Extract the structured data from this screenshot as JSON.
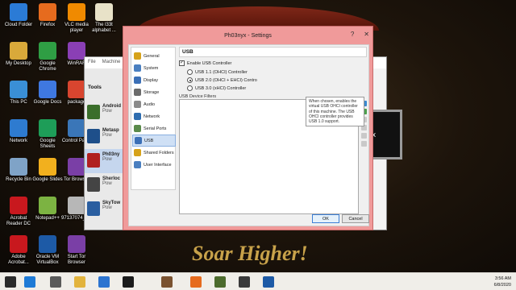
{
  "desktop_icons": [
    {
      "label": "Cloud Folder",
      "icon": "cloud-folder-icon",
      "color": "#2b7bd6"
    },
    {
      "label": "Firefox",
      "icon": "firefox-icon",
      "color": "#e66b1e"
    },
    {
      "label": "VLC media player",
      "icon": "vlc-icon",
      "color": "#f08a00"
    },
    {
      "label": "The l33t alphabet ...",
      "icon": "text-file-icon",
      "color": "#e8e2c8"
    },
    {
      "label": "My Desktop",
      "icon": "my-desktop-icon",
      "color": "#d9a93a"
    },
    {
      "label": "Google Chrome",
      "icon": "chrome-icon",
      "color": "#2f9e44"
    },
    {
      "label": "WinRAR",
      "icon": "winrar-icon",
      "color": "#8a3fb5"
    },
    {
      "label": "This PC",
      "icon": "this-pc-icon",
      "color": "#3a8fd6"
    },
    {
      "label": "Google Docs",
      "icon": "google-docs-icon",
      "color": "#3f78e0"
    },
    {
      "label": "package",
      "icon": "chrome-package-icon",
      "color": "#d8452f"
    },
    {
      "label": "Network",
      "icon": "network-icon",
      "color": "#2e7bd0"
    },
    {
      "label": "Google Sheets",
      "icon": "google-sheets-icon",
      "color": "#1e9d58"
    },
    {
      "label": "Control Panel",
      "icon": "control-panel-icon",
      "color": "#3a76b8"
    },
    {
      "label": "Recycle Bin",
      "icon": "recycle-bin-icon",
      "color": "#7fa3c7"
    },
    {
      "label": "Google Slides",
      "icon": "google-slides-icon",
      "color": "#f2b01e"
    },
    {
      "label": "Tor Browser",
      "icon": "tor-browser-icon",
      "color": "#7a3fa6"
    },
    {
      "label": "Acrobat Reader DC",
      "icon": "acrobat-icon",
      "color": "#c8181e"
    },
    {
      "label": "Notepad++",
      "icon": "notepad-plus-icon",
      "color": "#7cb342"
    },
    {
      "label": "97137074_2...",
      "icon": "image-file-icon",
      "color": "#b7b7b7"
    },
    {
      "label": "Adobe Acrobat...",
      "icon": "adobe-acrobat-icon",
      "color": "#c8181e"
    },
    {
      "label": "Oracle VM VirtualBox",
      "icon": "virtualbox-icon",
      "color": "#1d5aa6"
    },
    {
      "label": "Start Tor Browser",
      "icon": "start-tor-icon",
      "color": "#7a3fa6"
    }
  ],
  "wallpaper": {
    "slogan": "Soar Higher!"
  },
  "manager": {
    "menu": [
      "File",
      "Machine"
    ],
    "tools_label": "Tools",
    "vms": [
      {
        "name": "Android",
        "state": "Pow"
      },
      {
        "name": "Metasp",
        "state": "Pow"
      },
      {
        "name": "Ph03ny",
        "state": "Pow"
      },
      {
        "name": "Sherloc",
        "state": "Pow"
      },
      {
        "name": "SkyTow",
        "state": "Pow"
      }
    ],
    "preview_glyph": "x"
  },
  "dialog": {
    "title": "Ph03nyx - Settings",
    "controls": {
      "help": "?",
      "close": "✕"
    },
    "nav": [
      {
        "label": "General",
        "icon": "general-icon",
        "color": "#d6a21a"
      },
      {
        "label": "System",
        "icon": "system-icon",
        "color": "#4a7fc0"
      },
      {
        "label": "Display",
        "icon": "display-icon",
        "color": "#3b6fb6"
      },
      {
        "label": "Storage",
        "icon": "storage-icon",
        "color": "#6b6b6b"
      },
      {
        "label": "Audio",
        "icon": "audio-icon",
        "color": "#8a8a8a"
      },
      {
        "label": "Network",
        "icon": "network-icon",
        "color": "#2e6db0"
      },
      {
        "label": "Serial Ports",
        "icon": "serial-ports-icon",
        "color": "#5a8a4a"
      },
      {
        "label": "USB",
        "icon": "usb-icon",
        "color": "#3b6fb6"
      },
      {
        "label": "Shared Folders",
        "icon": "shared-folders-icon",
        "color": "#d6a21a"
      },
      {
        "label": "User Interface",
        "icon": "user-interface-icon",
        "color": "#4a7fc0"
      }
    ],
    "active_nav": "USB",
    "pane_title": "USB",
    "enable_usb": {
      "label": "Enable USB Controller",
      "checked": true
    },
    "controllers": [
      {
        "label": "USB 1.1 (OHCI) Controller",
        "selected": false
      },
      {
        "label": "USB 2.0 (OHCI + EHCI) Contro",
        "selected": true
      },
      {
        "label": "USB 3.0 (xHCI) Controller",
        "selected": false
      }
    ],
    "filters_label": "USB Device Filters",
    "tooltip": "When chosen, enables the virtual USB OHCI controller of this machine. The USB OHCI controller provides USB 1.0 support.",
    "ok_label": "OK",
    "cancel_label": "Cancel"
  },
  "taskbar": {
    "icons": [
      {
        "name": "start-icon",
        "color": "#2b2b2b"
      },
      {
        "name": "edge-icon",
        "color": "#1e7ad6"
      },
      {
        "name": "store-icon",
        "color": "#5a5a5a"
      },
      {
        "name": "folder-icon",
        "color": "#e2b33d"
      },
      {
        "name": "mail-icon",
        "color": "#2c74d0"
      },
      {
        "name": "terminal-icon",
        "color": "#1b1b1b"
      },
      {
        "name": "photos-icon",
        "color": "#7a5230"
      },
      {
        "name": "firefox-icon",
        "color": "#e66b1e"
      },
      {
        "name": "game-icon",
        "color": "#4c6b2d"
      },
      {
        "name": "media-icon",
        "color": "#3a3a3a"
      },
      {
        "name": "virtualbox-icon",
        "color": "#1d5aa6"
      }
    ],
    "time": "3:56 AM",
    "date": "6/8/2020"
  }
}
